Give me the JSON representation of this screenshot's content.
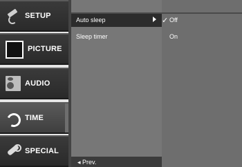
{
  "menu": {
    "items": [
      {
        "label": "SETUP",
        "icon": "satellite-dish-icon"
      },
      {
        "label": "PICTURE",
        "icon": "tv-screen-icon"
      },
      {
        "label": "AUDIO",
        "icon": "speaker-icon"
      },
      {
        "label": "TIME",
        "icon": "clock-icon"
      },
      {
        "label": "SPECIAL",
        "icon": "wrench-icon"
      }
    ],
    "active": "TIME"
  },
  "submenu": {
    "items": [
      "Auto sleep",
      "Sleep timer"
    ],
    "selected": "Auto sleep",
    "prev_label": "◂ Prev."
  },
  "options": {
    "items": [
      "Off",
      "On"
    ],
    "checked": "Off",
    "check_glyph": "✓"
  }
}
